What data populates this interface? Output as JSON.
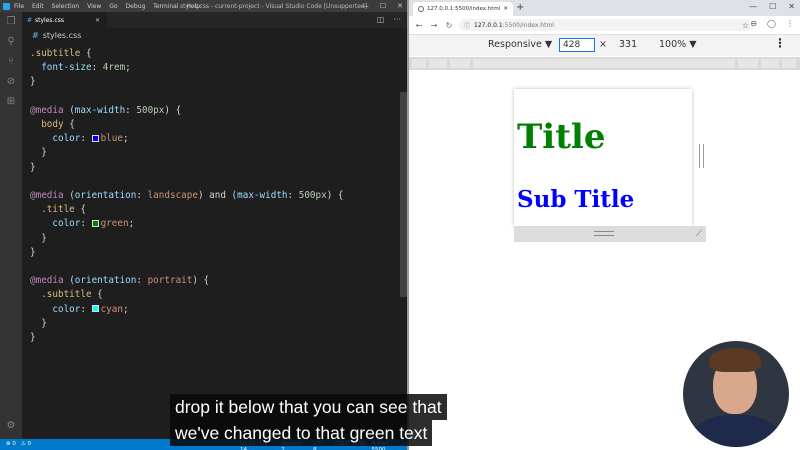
{
  "vscode": {
    "titlebar": {
      "menu": [
        "File",
        "Edit",
        "Selection",
        "View",
        "Go",
        "Debug",
        "Terminal",
        "Help"
      ],
      "window_title": "styles.css - current-project - Visual Studio Code [Unsupported]"
    },
    "tab": {
      "label": "styles.css"
    },
    "breadcrumb": "styles.css",
    "code_lines": [
      [
        {
          "t": ".subtitle",
          "c": "sel"
        },
        {
          "t": " {",
          "c": ""
        }
      ],
      [
        {
          "t": "  font-size",
          "c": "prop"
        },
        {
          "t": ": ",
          "c": ""
        },
        {
          "t": "4rem",
          "c": "num"
        },
        {
          "t": ";",
          "c": ""
        }
      ],
      [
        {
          "t": "}",
          "c": ""
        }
      ],
      [],
      [
        {
          "t": "@media",
          "c": "kw"
        },
        {
          "t": " (",
          "c": ""
        },
        {
          "t": "max-width",
          "c": "prop"
        },
        {
          "t": ": ",
          "c": ""
        },
        {
          "t": "500px",
          "c": "num"
        },
        {
          "t": ") {",
          "c": ""
        }
      ],
      [
        {
          "t": "  body",
          "c": "sel"
        },
        {
          "t": " {",
          "c": ""
        }
      ],
      [
        {
          "t": "    color",
          "c": "prop"
        },
        {
          "t": ": ",
          "c": ""
        },
        {
          "sw": "#0000ff"
        },
        {
          "t": "blue",
          "c": "val"
        },
        {
          "t": ";",
          "c": ""
        }
      ],
      [
        {
          "t": "  }",
          "c": ""
        }
      ],
      [
        {
          "t": "}",
          "c": ""
        }
      ],
      [],
      [
        {
          "t": "@media",
          "c": "kw"
        },
        {
          "t": " (",
          "c": ""
        },
        {
          "t": "orientation",
          "c": "prop"
        },
        {
          "t": ": ",
          "c": ""
        },
        {
          "t": "landscape",
          "c": "val"
        },
        {
          "t": ") and (",
          "c": ""
        },
        {
          "t": "max-width",
          "c": "prop"
        },
        {
          "t": ": ",
          "c": ""
        },
        {
          "t": "500px",
          "c": "num"
        },
        {
          "t": ") {",
          "c": ""
        }
      ],
      [
        {
          "t": "  .title",
          "c": "sel"
        },
        {
          "t": " {",
          "c": ""
        }
      ],
      [
        {
          "t": "    color",
          "c": "prop"
        },
        {
          "t": ": ",
          "c": ""
        },
        {
          "sw": "#008000"
        },
        {
          "t": "green",
          "c": "val"
        },
        {
          "t": ";",
          "c": ""
        }
      ],
      [
        {
          "t": "  }",
          "c": ""
        }
      ],
      [
        {
          "t": "}",
          "c": ""
        }
      ],
      [],
      [
        {
          "t": "@media",
          "c": "kw"
        },
        {
          "t": " (",
          "c": ""
        },
        {
          "t": "orientation",
          "c": "prop"
        },
        {
          "t": ": ",
          "c": ""
        },
        {
          "t": "portrait",
          "c": "val"
        },
        {
          "t": ") {",
          "c": ""
        }
      ],
      [
        {
          "t": "  .subtitle",
          "c": "sel"
        },
        {
          "t": " {",
          "c": ""
        }
      ],
      [
        {
          "t": "    color",
          "c": "prop"
        },
        {
          "t": ": ",
          "c": ""
        },
        {
          "sw": "#00ffff"
        },
        {
          "t": "cyan",
          "c": "val"
        },
        {
          "t": ";",
          "c": ""
        }
      ],
      [
        {
          "t": "  }",
          "c": ""
        }
      ],
      [
        {
          "t": "}",
          "c": ""
        }
      ]
    ],
    "statusbar": {
      "left": [
        "⊗ 0",
        "⚠ 0"
      ],
      "right": [
        "Ln 19, Col 14",
        "Spaces: 2",
        "UTF-8",
        "CRLF",
        "CSS",
        "⊘ Port : 5500"
      ]
    }
  },
  "chrome": {
    "tab_title": "127.0.0.1:5500/index.html",
    "url_host": "127.0.0.1",
    "url_path": ":5500/index.html",
    "devtools": {
      "device": "Responsive",
      "width": "428",
      "times": "×",
      "height": "331",
      "zoom": "100%"
    },
    "page": {
      "title": "Title",
      "subtitle": "Sub Title"
    }
  },
  "captions": {
    "line1": "drop it below that you can see that",
    "line2": "we've changed to that green text"
  },
  "colors": {
    "title_color": "#008000",
    "subtitle_color": "#0000ff",
    "vscode_status": "#007acc"
  }
}
